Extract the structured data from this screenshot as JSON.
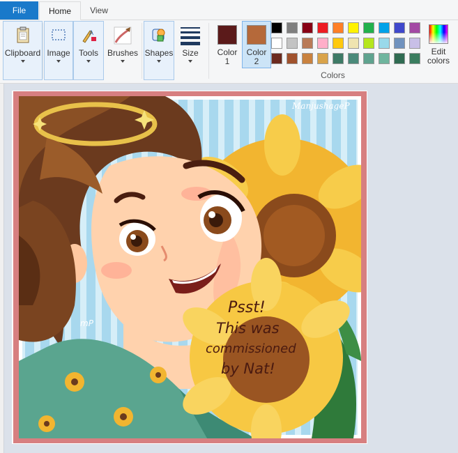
{
  "tabs": {
    "file": "File",
    "home": "Home",
    "view": "View"
  },
  "ribbon": {
    "clipboard": "Clipboard",
    "image": "Image",
    "tools": "Tools",
    "brushes": "Brushes",
    "shapes": "Shapes",
    "size": "Size",
    "colors_group": "Colors",
    "color1": {
      "label": "Color 1",
      "value": "#5b1a1a"
    },
    "color2": {
      "label": "Color 2",
      "value": "#b5693a"
    },
    "edit_colors": "Edit colors"
  },
  "palette": [
    "#000000",
    "#7f7f7f",
    "#880015",
    "#ed1c24",
    "#ff7f27",
    "#fff200",
    "#22b14c",
    "#00a2e8",
    "#3f48cc",
    "#a349a4",
    "#ffffff",
    "#c3c3c3",
    "#b97a57",
    "#ffaec9",
    "#ffc90e",
    "#efe4b0",
    "#b5e61d",
    "#99d9ea",
    "#7092be",
    "#c8bfe7",
    "#6b2a1f",
    "#a0522d",
    "#c9823f",
    "#d9a34a",
    "#3e7a66",
    "#4a8a7a",
    "#5fa38f",
    "#6fb59e",
    "#2f6b52",
    "#3a7d5f"
  ],
  "artwork": {
    "signature": "ManjushageP",
    "note_line1": "Psst!",
    "note_line2": "This was",
    "note_line3": "commissioned",
    "note_line4": "by Nat!",
    "corner_mark": "mP"
  }
}
